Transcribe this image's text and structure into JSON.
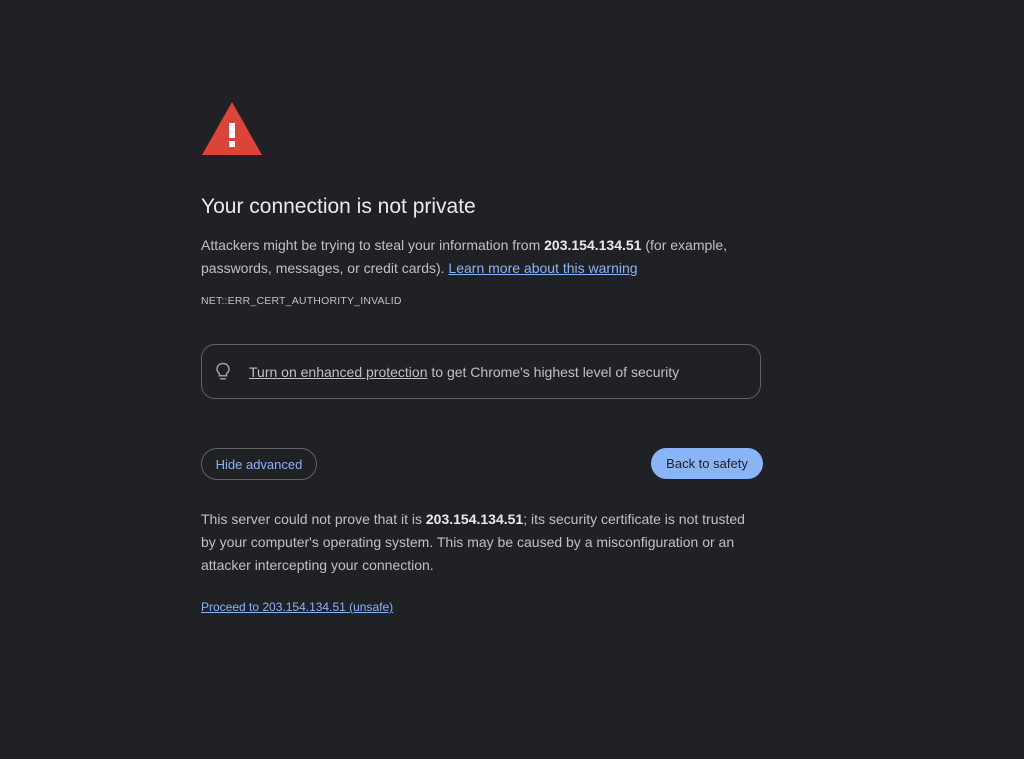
{
  "colors": {
    "background": "#202124",
    "warning_red": "#db4437",
    "link_blue": "#8ab4f8",
    "text": "#bdc1c6",
    "title": "#e8eaed"
  },
  "icons": {
    "warning": "warning-triangle-icon",
    "bulb": "lightbulb-icon"
  },
  "heading": {
    "title": "Your connection is not private"
  },
  "message": {
    "part1": "Attackers might be trying to steal your information from ",
    "host": "203.154.134.51",
    "part2": " (for example, passwords, messages, or credit cards). ",
    "learn_more": "Learn more about this warning"
  },
  "error_code": "NET::ERR_CERT_AUTHORITY_INVALID",
  "enhanced": {
    "link": "Turn on enhanced protection",
    "rest": " to get Chrome's highest level of security"
  },
  "buttons": {
    "hide_advanced": "Hide advanced",
    "back_to_safety": "Back to safety"
  },
  "details": {
    "part1": "This server could not prove that it is ",
    "host": "203.154.134.51",
    "part2": "; its security certificate is not trusted by your computer's operating system. This may be caused by a misconfiguration or an attacker intercepting your connection."
  },
  "proceed_link": "Proceed to 203.154.134.51 (unsafe)"
}
